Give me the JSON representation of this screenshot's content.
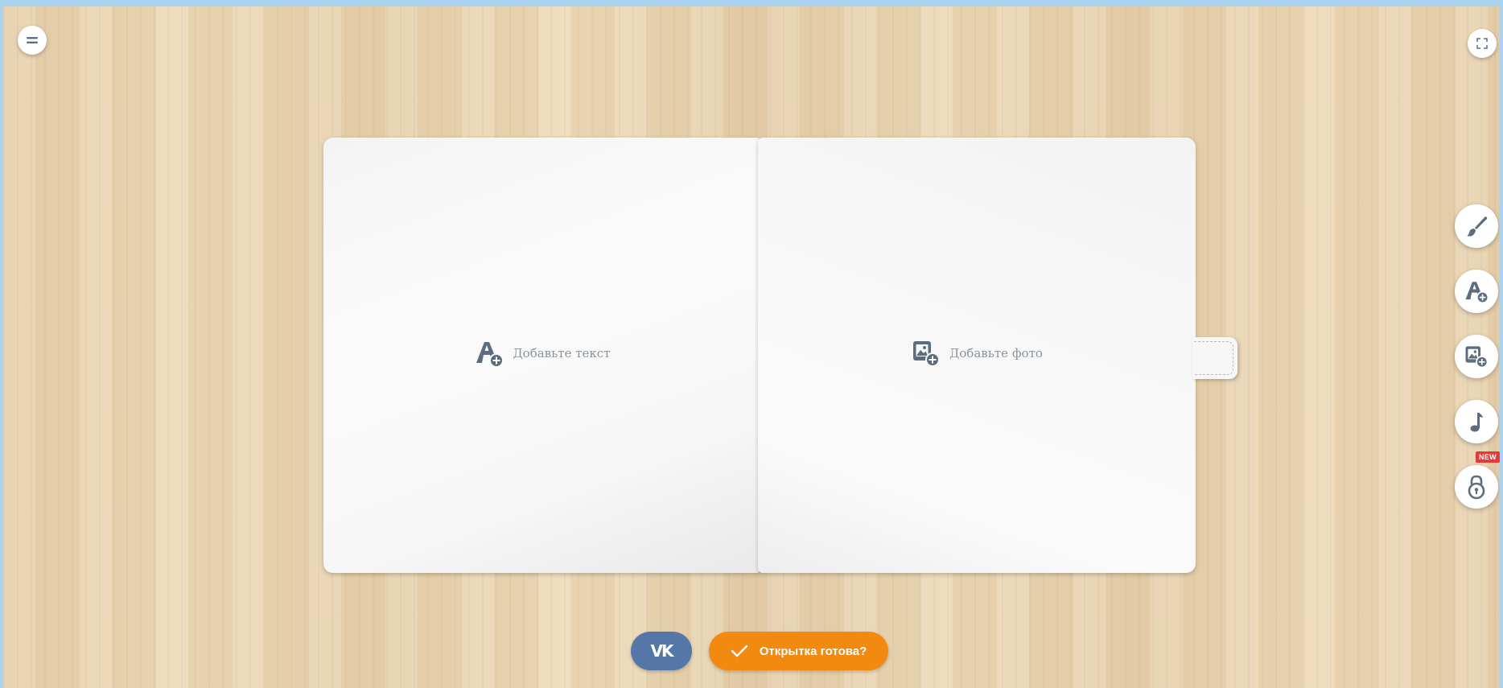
{
  "toolbar": {
    "menu_icon": "menu-icon",
    "fullscreen_icon": "fullscreen-icon"
  },
  "card": {
    "left_page": {
      "placeholder_label": "Добавьте текст",
      "icon": "add-text-icon"
    },
    "right_page": {
      "placeholder_label": "Добавьте фото",
      "icon": "add-photo-icon"
    }
  },
  "side_tools": [
    {
      "name": "brush",
      "icon": "brush-icon"
    },
    {
      "name": "add-text",
      "icon": "add-text-icon"
    },
    {
      "name": "add-photo",
      "icon": "add-photo-icon"
    },
    {
      "name": "music",
      "icon": "music-note-icon"
    },
    {
      "name": "lock",
      "icon": "lock-icon",
      "badge": "NEW"
    }
  ],
  "bottom": {
    "vk_label": "VK",
    "ready_label": "Открытка готова?"
  },
  "colors": {
    "accent_orange": "#f28a12",
    "vk_blue": "#5577a8",
    "icon_gray": "#5d6d7e",
    "badge_red": "#e53a3a"
  }
}
